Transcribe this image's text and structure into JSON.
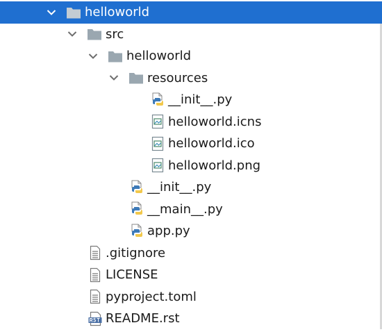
{
  "tree": {
    "items": [
      {
        "label": "helloworld",
        "type": "folder",
        "expanded": true,
        "selected": true
      },
      {
        "label": "src",
        "type": "folder",
        "expanded": true
      },
      {
        "label": "helloworld",
        "type": "folder",
        "expanded": true
      },
      {
        "label": "resources",
        "type": "folder",
        "expanded": true
      },
      {
        "label": "__init__.py",
        "type": "python-file"
      },
      {
        "label": "helloworld.icns",
        "type": "image-file"
      },
      {
        "label": "helloworld.ico",
        "type": "image-file"
      },
      {
        "label": "helloworld.png",
        "type": "image-file"
      },
      {
        "label": "__init__.py",
        "type": "python-file"
      },
      {
        "label": "__main__.py",
        "type": "python-file"
      },
      {
        "label": "app.py",
        "type": "python-file"
      },
      {
        "label": ".gitignore",
        "type": "text-file"
      },
      {
        "label": "LICENSE",
        "type": "text-file"
      },
      {
        "label": "pyproject.toml",
        "type": "text-file"
      },
      {
        "label": "README.rst",
        "type": "rst-file"
      }
    ]
  },
  "colors": {
    "selection": "#1f6fd0",
    "folder": "#9aa7b0",
    "chevron": "#6e6e6e",
    "python_blue": "#3d7ab8",
    "python_yellow": "#f2c84b"
  }
}
